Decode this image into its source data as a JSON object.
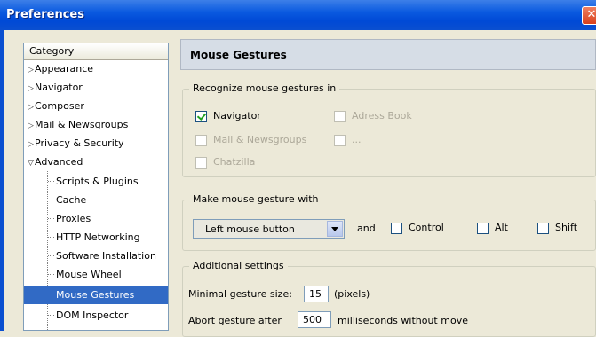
{
  "window": {
    "title": "Preferences",
    "close_glyph": "✕"
  },
  "category": {
    "header": "Category",
    "items": [
      {
        "label": "Appearance",
        "arrow": "▷"
      },
      {
        "label": "Navigator",
        "arrow": "▷"
      },
      {
        "label": "Composer",
        "arrow": "▷"
      },
      {
        "label": "Mail & Newsgroups",
        "arrow": "▷"
      },
      {
        "label": "Privacy & Security",
        "arrow": "▷"
      },
      {
        "label": "Advanced",
        "arrow": "▽"
      },
      {
        "label": "Scripts & Plugins"
      },
      {
        "label": "Cache"
      },
      {
        "label": "Proxies"
      },
      {
        "label": "HTTP Networking"
      },
      {
        "label": "Software Installation"
      },
      {
        "label": "Mouse Wheel"
      },
      {
        "label": "Mouse Gestures",
        "selected": true
      },
      {
        "label": "DOM Inspector"
      }
    ]
  },
  "panel": {
    "title": "Mouse Gestures",
    "recognize": {
      "legend": "Recognize mouse gestures in",
      "options": [
        {
          "label": "Navigator",
          "checked": true,
          "enabled": true
        },
        {
          "label": "Adress Book",
          "checked": false,
          "enabled": false
        },
        {
          "label": "Mail & Newsgroups",
          "checked": false,
          "enabled": false
        },
        {
          "label": "...",
          "checked": false,
          "enabled": false
        },
        {
          "label": "Chatzilla",
          "checked": false,
          "enabled": false
        }
      ]
    },
    "make": {
      "legend": "Make mouse gesture with",
      "button_select": "Left mouse button",
      "and_label": "and",
      "modifiers": [
        {
          "label": "Control",
          "checked": false
        },
        {
          "label": "Alt",
          "checked": false
        },
        {
          "label": "Shift",
          "checked": false
        }
      ]
    },
    "additional": {
      "legend": "Additional settings",
      "min_size_label": "Minimal gesture size:",
      "min_size_value": "15",
      "min_size_unit": "(pixels)",
      "abort_label": "Abort gesture after",
      "abort_value": "500",
      "abort_unit": "milliseconds without move"
    }
  }
}
